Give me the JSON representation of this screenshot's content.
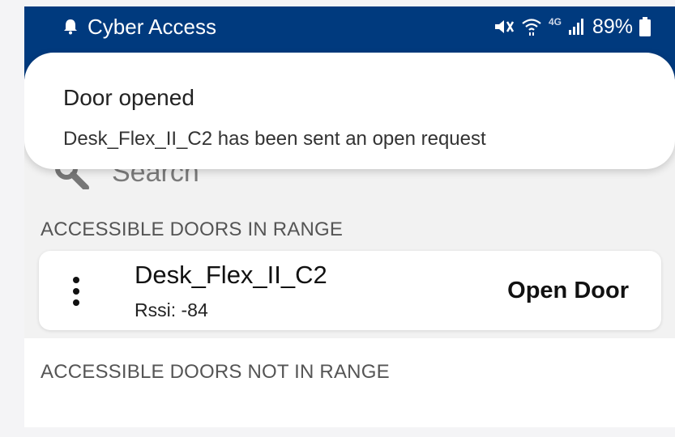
{
  "status_bar": {
    "app_title": "Cyber Access",
    "battery_percent": "89%",
    "network_label": "4G",
    "icons": [
      "notification-bell-icon",
      "mute-icon",
      "wifi-icon",
      "signal-icon",
      "battery-icon"
    ]
  },
  "notification": {
    "title": "Door opened",
    "message": "Desk_Flex_II_C2 has been sent an open request"
  },
  "search": {
    "placeholder": "Search"
  },
  "sections": {
    "in_range_label": "ACCESSIBLE DOORS IN RANGE",
    "not_in_range_label": "ACCESSIBLE DOORS NOT IN RANGE"
  },
  "doors_in_range": [
    {
      "name": "Desk_Flex_II_C2",
      "rssi": "Rssi: -84",
      "action_label": "Open Door"
    }
  ],
  "colors": {
    "primary": "#003a7e",
    "background": "#f2f2f2",
    "card": "#ffffff",
    "text": "#111111"
  }
}
